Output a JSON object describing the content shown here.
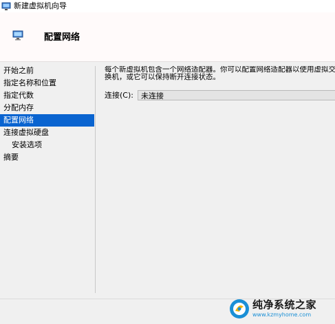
{
  "window": {
    "title": "新建虚拟机向导"
  },
  "header": {
    "title": "配置网络"
  },
  "nav": {
    "items": [
      {
        "label": "开始之前",
        "selected": false,
        "indent": false
      },
      {
        "label": "指定名称和位置",
        "selected": false,
        "indent": false
      },
      {
        "label": "指定代数",
        "selected": false,
        "indent": false
      },
      {
        "label": "分配内存",
        "selected": false,
        "indent": false
      },
      {
        "label": "配置网络",
        "selected": true,
        "indent": false
      },
      {
        "label": "连接虚拟硬盘",
        "selected": false,
        "indent": false
      },
      {
        "label": "安装选项",
        "selected": false,
        "indent": true
      },
      {
        "label": "摘要",
        "selected": false,
        "indent": false
      }
    ]
  },
  "content": {
    "description": "每个新虚拟机包含一个网络适配器。你可以配置网络适配器以使用虚拟交换机，或它可以保持断开连接状态。",
    "connection_label": "连接(C):",
    "connection_value": "未连接"
  },
  "watermark": {
    "title": "纯净系统之家",
    "url": "www.kzmyhome.com"
  },
  "colors": {
    "selected_bg": "#0a64d0",
    "header_bg": "#fffafa",
    "window_bg": "#f0f0f0"
  }
}
